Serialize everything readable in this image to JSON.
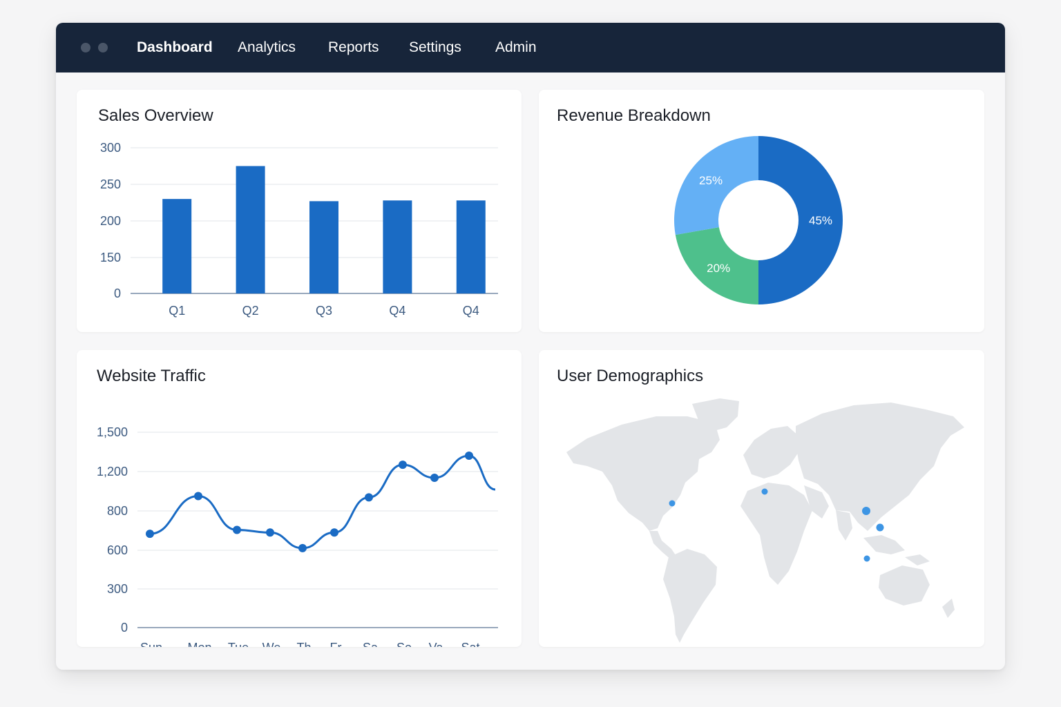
{
  "nav": {
    "items": [
      {
        "label": "Dashboard",
        "active": true
      },
      {
        "label": "Analytics",
        "active": false
      },
      {
        "label": "Reports",
        "active": false
      },
      {
        "label": "Settings",
        "active": false
      },
      {
        "label": "Admin",
        "active": false
      }
    ]
  },
  "colors": {
    "topbar": "#17253a",
    "primary": "#1a6bc4",
    "light_blue": "#64b0f5",
    "green": "#4ec08c",
    "map_land": "#e3e5e8",
    "marker": "#3d95e4"
  },
  "cards": {
    "sales": {
      "title": "Sales Overview"
    },
    "revenue": {
      "title": "Revenue Breakdown"
    },
    "traffic": {
      "title": "Website Traffic"
    },
    "demographics": {
      "title": "User Demographics"
    }
  },
  "chart_data": [
    {
      "id": "sales",
      "type": "bar",
      "title": "Sales Overview",
      "categories": [
        "Q1",
        "Q2",
        "Q3",
        "Q4",
        "Q4"
      ],
      "values": [
        230,
        275,
        227,
        228,
        228
      ],
      "yticks": [
        "300",
        "250",
        "200",
        "150",
        "0"
      ],
      "grid": true
    },
    {
      "id": "revenue",
      "type": "pie",
      "donut": true,
      "title": "Revenue Breakdown",
      "slices": [
        {
          "label": "45%",
          "value": 45,
          "color": "#1a6bc4"
        },
        {
          "label": "20%",
          "value": 20,
          "color": "#4ec08c"
        },
        {
          "label": "25%",
          "value": 25,
          "color": "#64b0f5"
        }
      ]
    },
    {
      "id": "traffic",
      "type": "line",
      "title": "Website Traffic",
      "categories": [
        "Sun",
        "Mon",
        "Tue",
        "We",
        "Th",
        "Fr",
        "Sa",
        "So",
        "Va",
        "Sat"
      ],
      "values": [
        720,
        1010,
        750,
        730,
        610,
        730,
        1000,
        1250,
        1150,
        1320
      ],
      "end_value": 1060,
      "yticks": [
        "1,500",
        "1,200",
        "800",
        "600",
        "300",
        "0"
      ],
      "grid": true
    }
  ]
}
